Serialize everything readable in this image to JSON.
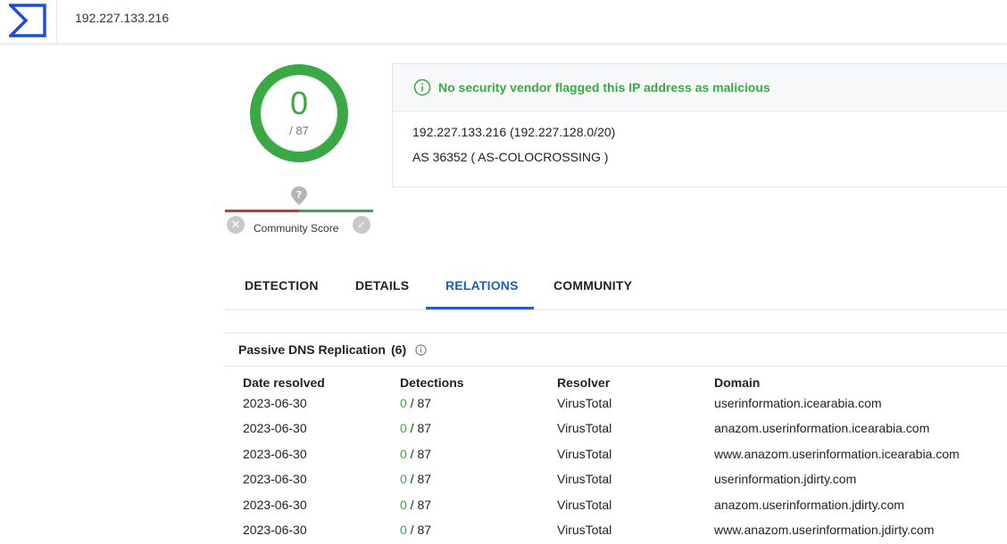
{
  "header": {
    "logo_icon": "virustotal-sigma-icon",
    "search_value": "192.227.133.216"
  },
  "score": {
    "detections": "0",
    "total": "/ 87",
    "ring_color": "#3aa845",
    "fraction_malicious": 0
  },
  "community": {
    "question_icon": "question-icon",
    "label": "Community Score",
    "downvote_icon": "close-icon",
    "upvote_icon": "check-icon"
  },
  "info": {
    "status_message": "No security vendor flagged this IP address as malicious",
    "ip_line": "192.227.133.216  (192.227.128.0/20)",
    "as_line": "AS 36352  ( AS-COLOCROSSING )",
    "status_color": "#3aa845"
  },
  "tabs": [
    {
      "label": "DETECTION",
      "active": false
    },
    {
      "label": "DETAILS",
      "active": false
    },
    {
      "label": "RELATIONS",
      "active": true
    },
    {
      "label": "COMMUNITY",
      "active": false
    }
  ],
  "passive_dns": {
    "title": "Passive DNS Replication",
    "count": "(6)",
    "columns": [
      "Date resolved",
      "Detections",
      "Resolver",
      "Domain"
    ],
    "rows": [
      {
        "date": "2023-06-30",
        "det": "0",
        "total": " / 87",
        "resolver": "VirusTotal",
        "domain": "userinformation.icearabia.com"
      },
      {
        "date": "2023-06-30",
        "det": "0",
        "total": " / 87",
        "resolver": "VirusTotal",
        "domain": "anazom.userinformation.icearabia.com"
      },
      {
        "date": "2023-06-30",
        "det": "0",
        "total": " / 87",
        "resolver": "VirusTotal",
        "domain": "www.anazom.userinformation.icearabia.com"
      },
      {
        "date": "2023-06-30",
        "det": "0",
        "total": " / 87",
        "resolver": "VirusTotal",
        "domain": "userinformation.jdirty.com"
      },
      {
        "date": "2023-06-30",
        "det": "0",
        "total": " / 87",
        "resolver": "VirusTotal",
        "domain": "anazom.userinformation.jdirty.com"
      },
      {
        "date": "2023-06-30",
        "det": "0",
        "total": " / 87",
        "resolver": "VirusTotal",
        "domain": "www.anazom.userinformation.jdirty.com"
      }
    ]
  },
  "colors": {
    "accent": "#1f5fbf",
    "clean": "#3aa845",
    "malicious": "#c0392b"
  }
}
